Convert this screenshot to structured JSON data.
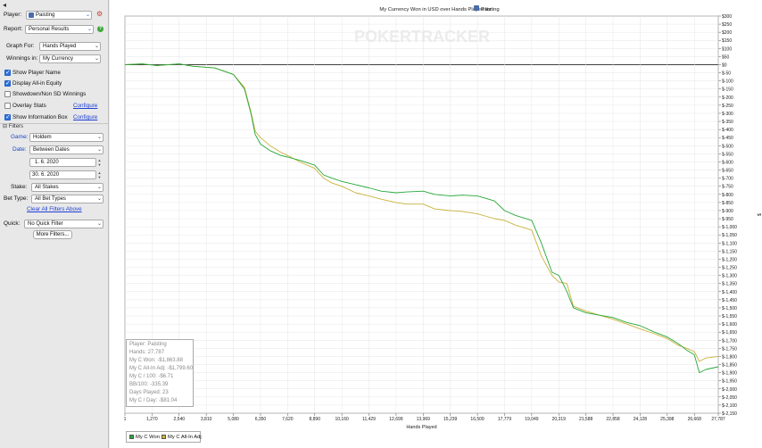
{
  "sidebar": {
    "player_label": "Player:",
    "player_value": "Paisting",
    "report_label": "Report:",
    "report_value": "Personal Results",
    "graph_for_label": "Graph For:",
    "graph_for_value": "Hands Played",
    "winnings_in_label": "Winnings in:",
    "winnings_in_value": "My Currency",
    "checkboxes": [
      {
        "label": "Show Player Name",
        "checked": true
      },
      {
        "label": "Display All-in Equity",
        "checked": true
      },
      {
        "label": "Showdown/Non SD Winnings",
        "checked": false
      },
      {
        "label": "Overlay Stats",
        "checked": false,
        "link": "Configure"
      },
      {
        "label": "Show Information Box",
        "checked": true,
        "link": "Configure"
      }
    ],
    "filters_header": "Filters",
    "game_label": "Game:",
    "game_value": "Holdem",
    "date_label": "Date:",
    "date_value": "Between Dates",
    "date_from": "1. 6. 2020",
    "date_to": "30. 6. 2020",
    "stake_label": "Stake:",
    "stake_value": "All Stakes",
    "bet_type_label": "Bet Type:",
    "bet_type_value": "All Bet Types",
    "clear_filters": "Clear All Filters Above",
    "quick_label": "Quick:",
    "quick_value": "No Quick Filter",
    "more_filters": "More Filters..."
  },
  "graph": {
    "title": "My Currency Won in USD over Hands Played for",
    "title_player": "Paisting",
    "watermark": "POKERTRACKER",
    "stats": [
      "Player: Paisting",
      "Hands: 27,787",
      "My C Won: -$1,863.88",
      "My C All-In Adj: -$1,799.60",
      "My C / 100: -$6.71",
      "BB/100: -335.39",
      "Days Played: 23",
      "My C / Day: -$81.04"
    ],
    "legend": [
      {
        "name": "My C Won",
        "color": "#26a83a"
      },
      {
        "name": "My C All-In Adj",
        "color": "#c9b23a"
      }
    ]
  },
  "chart_data": {
    "type": "line",
    "title": "My Currency Won in USD over Hands Played for Paisting",
    "xlabel": "Hands Played",
    "ylabel": "$",
    "xlim": [
      1,
      27787
    ],
    "ylim": [
      -2150,
      300
    ],
    "x_ticks": [
      "1",
      "1,270",
      "2,540",
      "3,810",
      "5,080",
      "6,350",
      "7,620",
      "8,890",
      "10,160",
      "11,429",
      "12,699",
      "13,969",
      "15,239",
      "16,509",
      "17,779",
      "19,049",
      "20,319",
      "21,588",
      "22,858",
      "24,128",
      "25,398",
      "26,668",
      "27,787"
    ],
    "y_ticks": [
      "$300",
      "$250",
      "$200",
      "$150",
      "$100",
      "$50",
      "$0",
      "$-50",
      "$-100",
      "$-150",
      "$-200",
      "$-250",
      "$-300",
      "$-350",
      "$-400",
      "$-450",
      "$-500",
      "$-550",
      "$-600",
      "$-650",
      "$-700",
      "$-750",
      "$-800",
      "$-850",
      "$-900",
      "$-950",
      "$-1,000",
      "$-1,050",
      "$-1,100",
      "$-1,150",
      "$-1,200",
      "$-1,250",
      "$-1,300",
      "$-1,350",
      "$-1,400",
      "$-1,450",
      "$-1,500",
      "$-1,550",
      "$-1,600",
      "$-1,650",
      "$-1,700",
      "$-1,750",
      "$-1,800",
      "$-1,850",
      "$-1,900",
      "$-1,950",
      "$-2,000",
      "$-2,050",
      "$-2,100",
      "$-2,150"
    ],
    "grid": true,
    "legend_position": "bottom-left",
    "series": [
      {
        "name": "My C Won",
        "color": "#26a83a",
        "points": [
          [
            1,
            0
          ],
          [
            800,
            5
          ],
          [
            1500,
            -5
          ],
          [
            2540,
            5
          ],
          [
            3200,
            -10
          ],
          [
            4200,
            -20
          ],
          [
            5080,
            -60
          ],
          [
            5600,
            -150
          ],
          [
            5900,
            -300
          ],
          [
            6100,
            -430
          ],
          [
            6350,
            -490
          ],
          [
            6800,
            -530
          ],
          [
            7300,
            -560
          ],
          [
            7620,
            -570
          ],
          [
            8200,
            -590
          ],
          [
            8890,
            -620
          ],
          [
            9300,
            -680
          ],
          [
            9700,
            -700
          ],
          [
            10160,
            -720
          ],
          [
            10800,
            -740
          ],
          [
            11429,
            -760
          ],
          [
            12000,
            -780
          ],
          [
            12699,
            -790
          ],
          [
            13200,
            -785
          ],
          [
            13969,
            -780
          ],
          [
            14500,
            -800
          ],
          [
            15239,
            -810
          ],
          [
            15800,
            -805
          ],
          [
            16509,
            -810
          ],
          [
            17300,
            -840
          ],
          [
            17779,
            -900
          ],
          [
            18300,
            -930
          ],
          [
            19049,
            -960
          ],
          [
            19500,
            -1100
          ],
          [
            20000,
            -1280
          ],
          [
            20319,
            -1300
          ],
          [
            20700,
            -1400
          ],
          [
            21000,
            -1500
          ],
          [
            21588,
            -1530
          ],
          [
            22200,
            -1545
          ],
          [
            22858,
            -1560
          ],
          [
            23500,
            -1590
          ],
          [
            24128,
            -1610
          ],
          [
            24800,
            -1650
          ],
          [
            25398,
            -1680
          ],
          [
            25900,
            -1720
          ],
          [
            26300,
            -1760
          ],
          [
            26668,
            -1790
          ],
          [
            26900,
            -1900
          ],
          [
            27200,
            -1880
          ],
          [
            27787,
            -1863.88
          ]
        ]
      },
      {
        "name": "My C All-In Adj",
        "color": "#c9b23a",
        "points": [
          [
            1,
            0
          ],
          [
            800,
            5
          ],
          [
            1500,
            -5
          ],
          [
            2540,
            5
          ],
          [
            3200,
            -10
          ],
          [
            4200,
            -20
          ],
          [
            5080,
            -60
          ],
          [
            5600,
            -140
          ],
          [
            5900,
            -290
          ],
          [
            6100,
            -410
          ],
          [
            6350,
            -450
          ],
          [
            6800,
            -500
          ],
          [
            7300,
            -540
          ],
          [
            7620,
            -560
          ],
          [
            8200,
            -600
          ],
          [
            8890,
            -640
          ],
          [
            9300,
            -700
          ],
          [
            9700,
            -730
          ],
          [
            10160,
            -750
          ],
          [
            10800,
            -790
          ],
          [
            11429,
            -810
          ],
          [
            12000,
            -830
          ],
          [
            12699,
            -850
          ],
          [
            13200,
            -860
          ],
          [
            13969,
            -860
          ],
          [
            14500,
            -890
          ],
          [
            15239,
            -900
          ],
          [
            15800,
            -905
          ],
          [
            16509,
            -920
          ],
          [
            17300,
            -950
          ],
          [
            17779,
            -960
          ],
          [
            18300,
            -990
          ],
          [
            19049,
            -1020
          ],
          [
            19500,
            -1180
          ],
          [
            20000,
            -1300
          ],
          [
            20319,
            -1340
          ],
          [
            20700,
            -1350
          ],
          [
            21000,
            -1490
          ],
          [
            21588,
            -1520
          ],
          [
            22200,
            -1545
          ],
          [
            22858,
            -1570
          ],
          [
            23500,
            -1600
          ],
          [
            24128,
            -1630
          ],
          [
            24800,
            -1660
          ],
          [
            25398,
            -1690
          ],
          [
            25900,
            -1730
          ],
          [
            26300,
            -1750
          ],
          [
            26668,
            -1770
          ],
          [
            26900,
            -1830
          ],
          [
            27200,
            -1810
          ],
          [
            27787,
            -1799.6
          ]
        ]
      }
    ]
  }
}
